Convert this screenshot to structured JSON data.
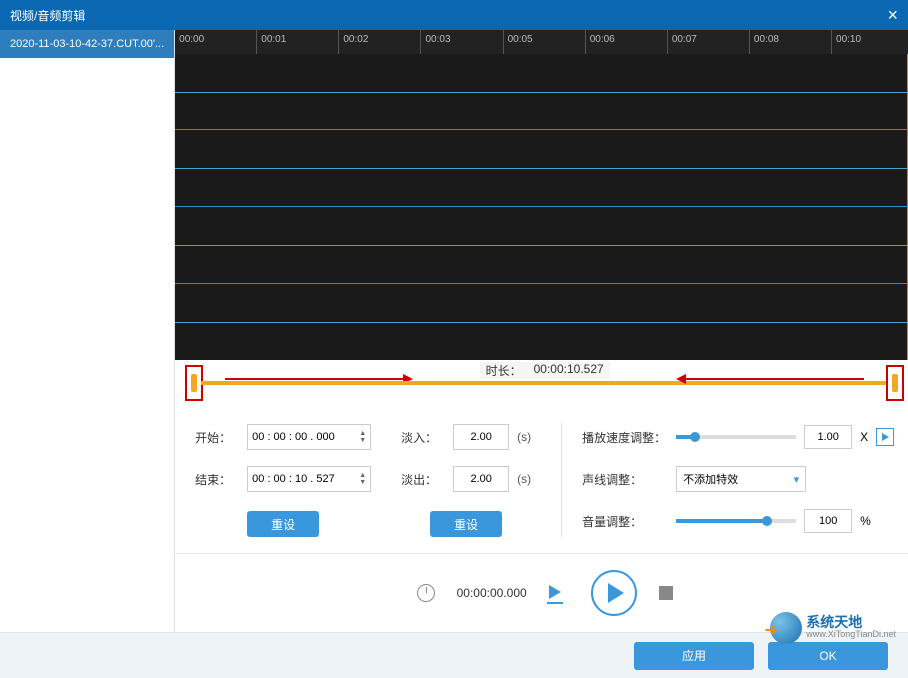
{
  "window": {
    "title": "视频/音频剪辑"
  },
  "sidebar": {
    "files": [
      {
        "name": "2020-11-03-10-42-37.CUT.00'..."
      }
    ]
  },
  "ruler": {
    "ticks": [
      "00:00",
      "00:01",
      "00:02",
      "00:03",
      "00:05",
      "00:06",
      "00:07",
      "00:08",
      "00:10"
    ]
  },
  "selection": {
    "duration_label": "时长：",
    "duration": "00:00:10.527"
  },
  "time": {
    "start_label": "开始：",
    "start": "00 : 00 : 00 . 000",
    "end_label": "结束：",
    "end": "00 : 00 : 10 . 527",
    "reset": "重设"
  },
  "fade": {
    "in_label": "淡入：",
    "in": "2.00",
    "out_label": "淡出：",
    "out": "2.00",
    "unit": "(s)",
    "reset": "重设"
  },
  "speed": {
    "label": "播放速度调整：",
    "value": "1.00",
    "x": "X"
  },
  "voice": {
    "label": "声线调整：",
    "selected": "不添加特效"
  },
  "volume": {
    "label": "音量调整：",
    "value": "100",
    "pct": "%"
  },
  "playback": {
    "time": "00:00:00.000"
  },
  "footer": {
    "apply": "应用",
    "ok": "OK"
  },
  "watermark": {
    "cn": "系统天地",
    "en": "www.XiTongTianDi.net"
  }
}
